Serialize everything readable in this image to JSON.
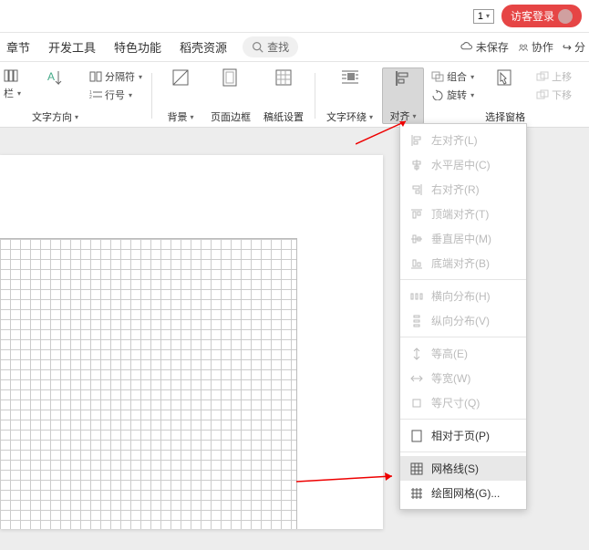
{
  "title_bar": {
    "page_num": "1",
    "login_label": "访客登录"
  },
  "tabs": {
    "items": [
      "章节",
      "开发工具",
      "特色功能",
      "稻壳资源"
    ],
    "search_placeholder": "查找",
    "status": {
      "unsaved": "未保存",
      "collab": "协作",
      "share": "分"
    }
  },
  "toolbar": {
    "col": "栏",
    "textdir": "文字方向",
    "pagebreak": "分隔符",
    "linenum": "行号",
    "background": "背景",
    "pageborder": "页面边框",
    "manuscript": "稿纸设置",
    "textwrap": "文字环绕",
    "align": "对齐",
    "rotate": "旋转",
    "group": "组合",
    "selectpane": "选择窗格",
    "moveup": "上移",
    "movedown": "下移"
  },
  "menu": {
    "left": "左对齐(L)",
    "hcenter": "水平居中(C)",
    "right": "右对齐(R)",
    "top": "顶端对齐(T)",
    "vcenter": "垂直居中(M)",
    "bottom": "底端对齐(B)",
    "disth": "横向分布(H)",
    "distv": "纵向分布(V)",
    "eqheight": "等高(E)",
    "eqwidth": "等宽(W)",
    "eqsize": "等尺寸(Q)",
    "relpage": "相对于页(P)",
    "gridlines": "网格线(S)",
    "drawgrid": "绘图网格(G)..."
  }
}
